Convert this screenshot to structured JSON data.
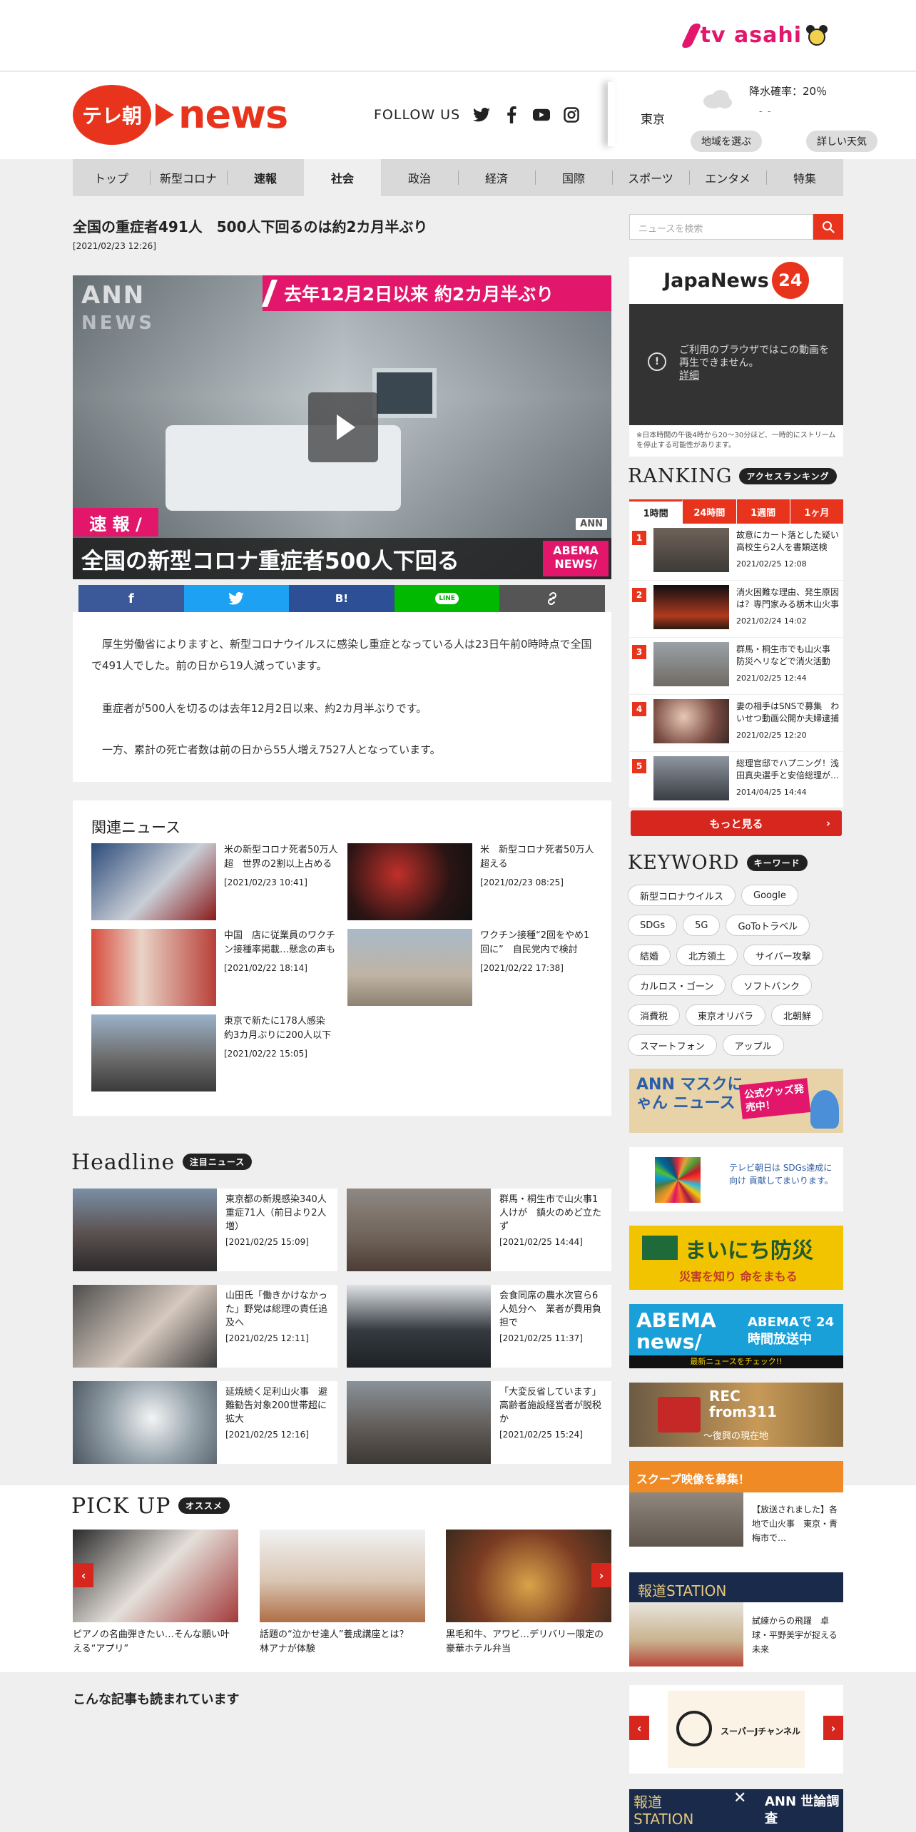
{
  "brand": {
    "tvasahi": "tv asahi",
    "logo_jp": "テレ朝",
    "logo_news": "news"
  },
  "follow": {
    "label": "FOLLOW US"
  },
  "weather": {
    "city": "東京",
    "rain": "降水確率：20％",
    "rain_dots": "-  -",
    "area_btn": "地域を選ぶ",
    "detail_btn": "詳しい天気"
  },
  "nav": [
    "トップ",
    "新型コロナ",
    "速報",
    "社会",
    "政治",
    "経済",
    "国際",
    "スポーツ",
    "エンタメ",
    "特集"
  ],
  "article": {
    "title": "全国の重症者491人　500人下回るのは約2カ月半ぶり",
    "date": "[2021/02/23 12:26]",
    "video": {
      "ann": "ANN",
      "ann_sub": "NEWS",
      "top_banner": "去年12月2日以来 約2カ月半ぶり",
      "sokuho": "速 報 /",
      "bottom": "全国の新型コロナ重症者500人下回る",
      "abema": "ABEMA NEWS/",
      "ann_logo": "ANN"
    },
    "share": {
      "fb": "f",
      "tw": "t",
      "hatena": "B!",
      "line": "LINE",
      "link": "⇔"
    },
    "paragraphs": [
      "厚生労働省によりますと、新型コロナウイルスに感染し重症となっている人は23日午前0時時点で全国で491人でした。前の日から19人減っています。",
      "重症者が500人を切るのは去年12月2日以来、約2カ月半ぶりです。",
      "一方、累計の死亡者数は前の日から55人増え7527人となっています。"
    ]
  },
  "related": {
    "title": "関連ニュース",
    "items": [
      {
        "title": "米の新型コロナ死者50万人超　世界の2割以上占める",
        "date": "[2021/02/23 10:41]"
      },
      {
        "title": "米　新型コロナ死者50万人超える",
        "date": "[2021/02/23 08:25]"
      },
      {
        "title": "中国　店に従業員のワクチン接種率掲載…懸念の声も",
        "date": "[2021/02/22 18:14]"
      },
      {
        "title": "ワクチン接種“2回をやめ1回に”　自民党内で検討",
        "date": "[2021/02/22 17:38]"
      },
      {
        "title": "東京で新たに178人感染　約3カ月ぶりに200人以下",
        "date": "[2021/02/22 15:05]"
      }
    ]
  },
  "headline": {
    "title": "Headline",
    "badge": "注目ニュース",
    "items": [
      {
        "title": "東京都の新規感染340人　重症71人（前日より2人増）",
        "date": "[2021/02/25 15:09]"
      },
      {
        "title": "群馬・桐生市で山火事1人けが　鎮火のめど立たず",
        "date": "[2021/02/25 14:44]"
      },
      {
        "title": "山田氏「働きかけなかった」野党は総理の責任追及へ",
        "date": "[2021/02/25 12:11]"
      },
      {
        "title": "会食同席の農水次官ら6人処分へ　業者が費用負担で",
        "date": "[2021/02/25 11:37]"
      },
      {
        "title": "延焼続く足利山火事　避難勧告対象200世帯超に拡大",
        "date": "[2021/02/25 12:16]"
      },
      {
        "title": "「大変反省しています」　高齢者施設経営者が脱税か",
        "date": "[2021/02/25 15:24]"
      }
    ]
  },
  "pickup": {
    "title": "PICK UP",
    "badge": "オススメ",
    "items": [
      {
        "title": "ピアノの名曲弾きたい…そんな願い叶える“アプリ”"
      },
      {
        "title": "話題の“泣かせ達人”養成講座とは？　林アナが体験"
      },
      {
        "title": "黒毛和牛、アワビ…デリバリー限定の豪華ホテル弁当"
      }
    ]
  },
  "also_read": "こんな記事も読まれています",
  "sidebar": {
    "search_placeholder": "ニュースを検索",
    "jnn": {
      "logo": "JapaNews",
      "logo24": "24",
      "msg": "ご利用のブラウザではこの動画を再生できません。",
      "link": "詳細",
      "note": "※日本時間の午後4時から20～30分ほど、一時的にストリームを停止する可能性があります。"
    },
    "ranking": {
      "title": "RANKING",
      "badge": "アクセスランキング",
      "tabs": [
        "1時間",
        "24時間",
        "1週間",
        "1ヶ月"
      ],
      "items": [
        {
          "num": "1",
          "title": "故意にカート落とした疑い　高校生ら2人を書類送検",
          "date": "2021/02/25 12:08"
        },
        {
          "num": "2",
          "title": "消火困難な理由、発生原因は？専門家みる栃木山火事",
          "date": "2021/02/24 14:02"
        },
        {
          "num": "3",
          "title": "群馬・桐生市でも山火事　防災ヘリなどで消火活動",
          "date": "2021/02/25 12:44"
        },
        {
          "num": "4",
          "title": "妻の相手はSNSで募集　わいせつ動画公開か夫婦逮捕",
          "date": "2021/02/25 12:20"
        },
        {
          "num": "5",
          "title": "総理官邸でハプニング！浅田真央選手と安倍総理が…",
          "date": "2014/04/25 14:44"
        }
      ],
      "more": "もっと見る"
    },
    "keyword": {
      "title": "KEYWORD",
      "badge": "キーワード",
      "items": [
        "新型コロナウイルス",
        "Google",
        "SDGs",
        "5G",
        "GoToトラベル",
        "結婚",
        "北方領土",
        "サイバー攻撃",
        "カルロス・ゴーン",
        "ソフトバンク",
        "消費税",
        "東京オリパラ",
        "北朝鮮",
        "スマートフォン",
        "アップル"
      ]
    },
    "banners": {
      "mask": "ANN マスクにゃん ニュース",
      "mask_goods": "公式グッズ発売中！",
      "sdgs": "テレビ朝日は SDGs達成に向け 貢献してまいります。",
      "bousai": "まいにち防災",
      "bousai_sub": "災害を知り 命をまもる",
      "abema": "ABEMA news/",
      "abema_sub": "ABEMAで 24時間放送中",
      "abema_ticker": "最新ニュースをチェック!!",
      "rec": "REC from311",
      "rec_sub": "～復興の現在地",
      "scoop": "スクープ映像を募集！",
      "scoop_item": "【放送されました】各地で山火事　東京・青梅市で…",
      "houdou": "報道STATION",
      "houdou_item": "試練からの飛躍　卓球・平野美宇が捉える未来",
      "superj": "スーパーJチャンネル",
      "bottom_left": "報道 STATION",
      "bottom_right": "ANN 世論調査"
    }
  },
  "colors": {
    "brand_red": "#e8341c",
    "tv_asahi_pink": "#e2176b",
    "facebook": "#3b5998",
    "twitter": "#1da1f2",
    "hatena": "#2c4f95",
    "line": "#00b900",
    "link": "#555555"
  }
}
